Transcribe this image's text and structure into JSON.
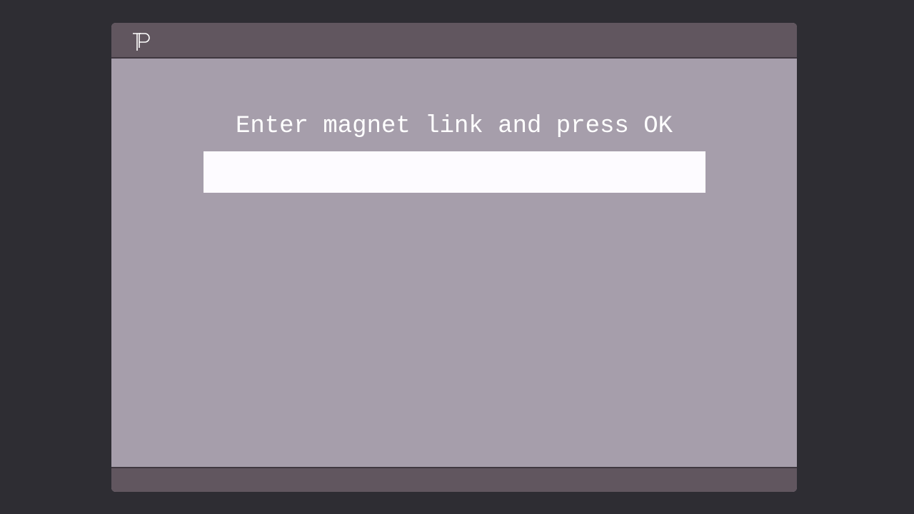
{
  "app": {
    "logo_icon": "tp-logo-icon"
  },
  "main": {
    "prompt": "Enter magnet link and press OK",
    "magnet_input": {
      "value": "",
      "placeholder": ""
    }
  },
  "colors": {
    "background": "#2e2d33",
    "titlebar": "#61565f",
    "content": "#a69eab",
    "input": "#fdfbff",
    "text": "#ffffff"
  }
}
